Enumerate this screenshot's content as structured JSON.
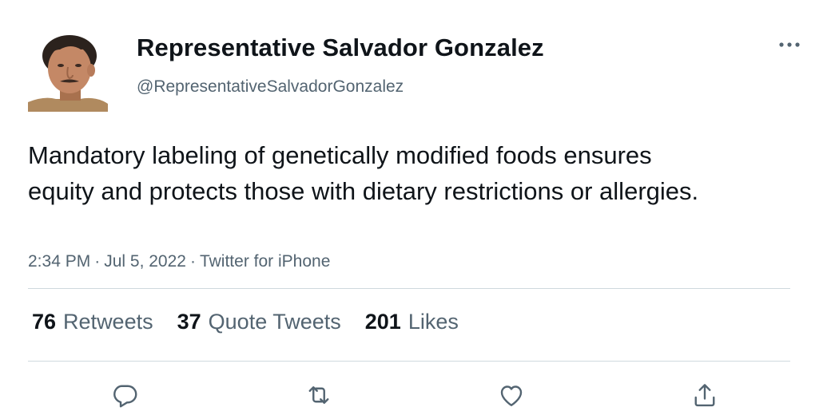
{
  "author": {
    "display_name": "Representative Salvador Gonzalez",
    "handle": "@RepresentativeSalvadorGonzalez",
    "avatar_icon": "profile-photo"
  },
  "tweet": {
    "text": "Mandatory labeling of genetically modified foods ensures equity and protects those with dietary restrictions or allergies.",
    "time": "2:34 PM",
    "date": "Jul 5, 2022",
    "source": "Twitter for iPhone",
    "separator": "·"
  },
  "stats": {
    "retweets": {
      "count": "76",
      "label": "Retweets"
    },
    "quote_tweets": {
      "count": "37",
      "label": "Quote Tweets"
    },
    "likes": {
      "count": "201",
      "label": "Likes"
    }
  },
  "actions": {
    "reply_icon": "reply-icon",
    "retweet_icon": "retweet-icon",
    "like_icon": "heart-icon",
    "share_icon": "share-icon"
  },
  "colors": {
    "text_primary": "#0f1419",
    "text_secondary": "#536471",
    "divider": "#cfd9de",
    "icon": "#536471"
  }
}
